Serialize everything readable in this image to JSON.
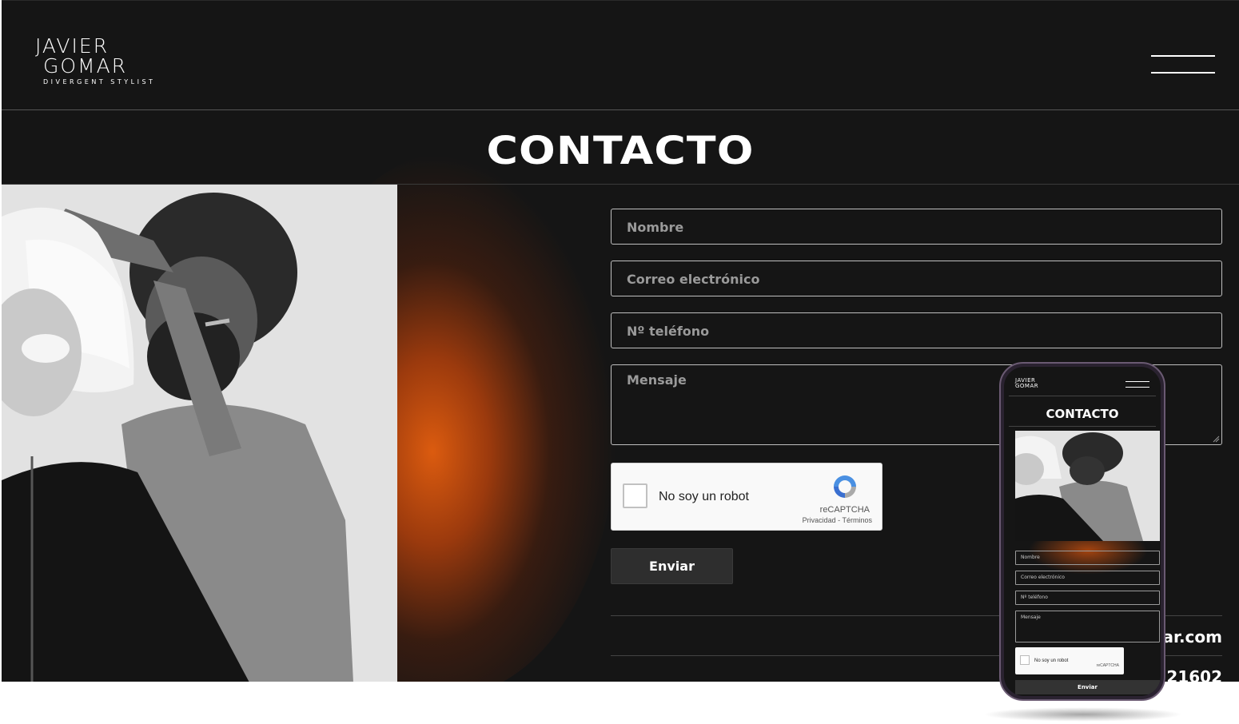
{
  "header": {
    "logo_line1": "JAVIER",
    "logo_line2": "GOMAR",
    "logo_tagline": "DIVERGENT STYLIST",
    "menu_icon": "hamburger-menu-icon"
  },
  "page_title": "CONTACTO",
  "form": {
    "name_placeholder": "Nombre",
    "email_placeholder": "Correo electrónico",
    "phone_placeholder": "Nº teléfono",
    "message_placeholder": "Mensaje",
    "captcha_label": "No soy un robot",
    "captcha_brand": "reCAPTCHA",
    "captcha_links": "Privacidad - Términos",
    "submit_label": "Enviar"
  },
  "contact_info": {
    "email_partial": "ar.com",
    "phone_partial": "21602"
  },
  "mobile_preview": {
    "logo_line1": "JAVIER",
    "logo_line2": "GOMAR",
    "title": "CONTACTO",
    "name_placeholder": "Nombre",
    "email_placeholder": "Correo electrónico",
    "phone_placeholder": "Nº teléfono",
    "message_placeholder": "Mensaje",
    "captcha_label": "No soy un robot",
    "captcha_brand": "reCAPTCHA",
    "submit_label": "Enviar"
  },
  "colors": {
    "background": "#151515",
    "accent_glow": "#e0600f",
    "field_border": "#bfbfbf",
    "button": "#2e2e2e"
  }
}
